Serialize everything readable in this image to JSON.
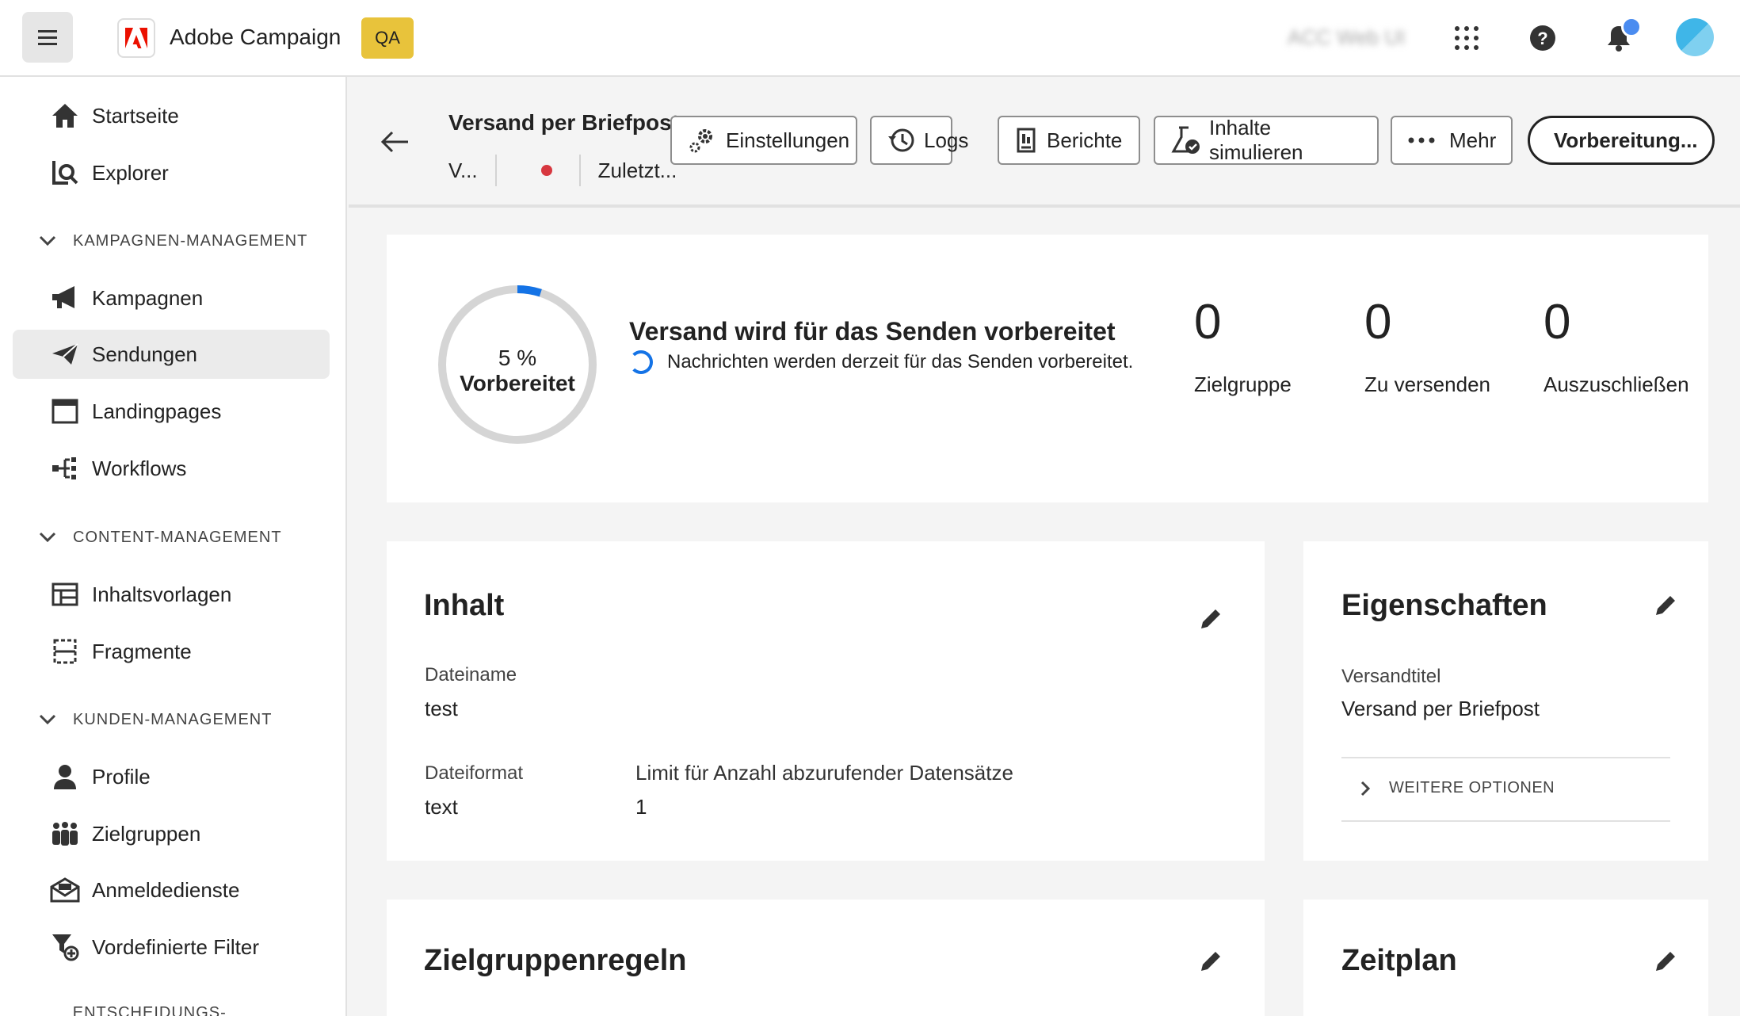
{
  "app": {
    "title": "Adobe Campaign",
    "env_badge": "QA",
    "org_name": "ACC Web UI"
  },
  "sidebar": {
    "top_items": [
      {
        "label": "Startseite",
        "icon": "home-icon"
      },
      {
        "label": "Explorer",
        "icon": "explorer-icon"
      }
    ],
    "sections": [
      {
        "title": "KAMPAGNEN-MANAGEMENT",
        "items": [
          {
            "label": "Kampagnen",
            "icon": "megaphone-icon"
          },
          {
            "label": "Sendungen",
            "icon": "send-icon",
            "active": true
          },
          {
            "label": "Landingpages",
            "icon": "landingpage-icon"
          },
          {
            "label": "Workflows",
            "icon": "workflow-icon"
          }
        ]
      },
      {
        "title": "CONTENT-MANAGEMENT",
        "items": [
          {
            "label": "Inhaltsvorlagen",
            "icon": "template-icon"
          },
          {
            "label": "Fragmente",
            "icon": "fragment-icon"
          }
        ]
      },
      {
        "title": "KUNDEN-MANAGEMENT",
        "items": [
          {
            "label": "Profile",
            "icon": "user-icon"
          },
          {
            "label": "Zielgruppen",
            "icon": "audience-icon"
          },
          {
            "label": "Anmeldedienste",
            "icon": "subscription-icon"
          },
          {
            "label": "Vordefinierte Filter",
            "icon": "filter-icon"
          }
        ]
      },
      {
        "title": "ENTSCHEIDUNGS-MANAGEMENT",
        "items": []
      }
    ]
  },
  "header": {
    "title": "Versand per Briefpost",
    "status_short": "V...",
    "last_modified_short": "Zuletzt...",
    "buttons": {
      "settings": "Einstellungen",
      "logs": "Logs",
      "reports": "Berichte",
      "simulate": "Inhalte simulieren",
      "more": "Mehr",
      "prepare": "Vorbereitung..."
    }
  },
  "progress": {
    "percent_label": "5 %",
    "percent_value": 0.05,
    "state_label": "Vorbereitet",
    "title": "Versand wird für das Senden vorbereitet",
    "subtitle": "Nachrichten werden derzeit für das Senden vorbereitet.",
    "stats": [
      {
        "value": "0",
        "label": "Zielgruppe"
      },
      {
        "value": "0",
        "label": "Zu versenden"
      },
      {
        "value": "0",
        "label": "Auszuschließen"
      }
    ]
  },
  "content_card": {
    "title": "Inhalt",
    "filename_label": "Dateiname",
    "filename_value": "test",
    "format_label": "Dateiformat",
    "format_value": "text",
    "limit_label": "Limit für Anzahl abzurufender Datensätze",
    "limit_value": "1"
  },
  "properties_card": {
    "title": "Eigenschaften",
    "label": "Versandtitel",
    "value": "Versand per Briefpost",
    "more_options": "WEITERE OPTIONEN"
  },
  "audience_card": {
    "title": "Zielgruppenregeln"
  },
  "schedule_card": {
    "title": "Zeitplan"
  },
  "colors": {
    "accent": "#1473e6",
    "status_dot": "#d7373f",
    "badge": "#e8c33b"
  }
}
